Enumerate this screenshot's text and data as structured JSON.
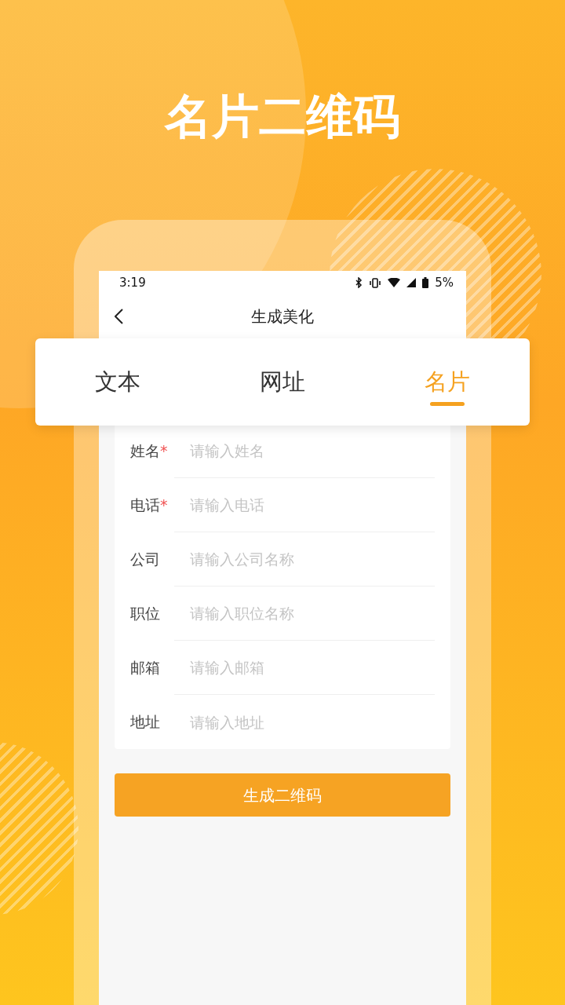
{
  "headline": "名片二维码",
  "status_bar": {
    "time": "3:19",
    "battery": "5%"
  },
  "nav": {
    "title": "生成美化"
  },
  "tabs": [
    {
      "label": "文本",
      "selected": false
    },
    {
      "label": "网址",
      "selected": false
    },
    {
      "label": "名片",
      "selected": true
    }
  ],
  "required_mark": "*",
  "fields": [
    {
      "label": "姓名",
      "placeholder": "请输入姓名",
      "required": true
    },
    {
      "label": "电话",
      "placeholder": "请输入电话",
      "required": true
    },
    {
      "label": "公司",
      "placeholder": "请输入公司名称",
      "required": false
    },
    {
      "label": "职位",
      "placeholder": "请输入职位名称",
      "required": false
    },
    {
      "label": "邮箱",
      "placeholder": "请输入邮箱",
      "required": false
    },
    {
      "label": "地址",
      "placeholder": "请输入地址",
      "required": false
    }
  ],
  "submit_button": "生成二维码"
}
